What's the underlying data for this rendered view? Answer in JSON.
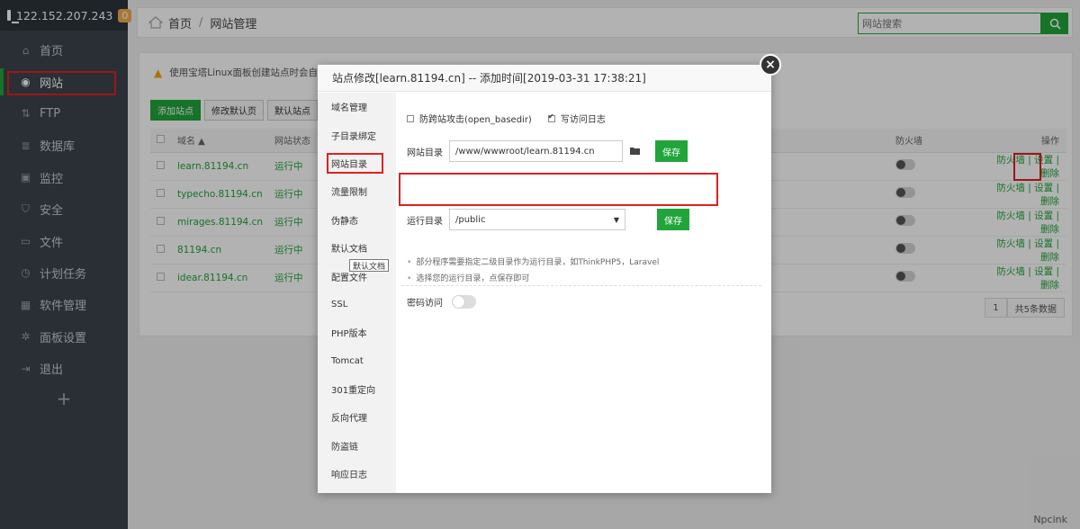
{
  "sidebar": {
    "ip": "122.152.207.243",
    "badge": "0",
    "items": [
      {
        "label": "首页",
        "icon": "home-icon"
      },
      {
        "label": "网站",
        "icon": "globe-icon"
      },
      {
        "label": "FTP",
        "icon": "ftp-icon"
      },
      {
        "label": "数据库",
        "icon": "database-icon"
      },
      {
        "label": "监控",
        "icon": "monitor-icon"
      },
      {
        "label": "安全",
        "icon": "shield-icon"
      },
      {
        "label": "文件",
        "icon": "folder-icon"
      },
      {
        "label": "计划任务",
        "icon": "clock-icon"
      },
      {
        "label": "软件管理",
        "icon": "apps-icon"
      },
      {
        "label": "面板设置",
        "icon": "gear-icon"
      },
      {
        "label": "退出",
        "icon": "logout-icon"
      }
    ],
    "add": "+"
  },
  "breadcrumb": {
    "home": "首页",
    "sep": "/",
    "current": "网站管理"
  },
  "search": {
    "placeholder": "网站搜索"
  },
  "panel": {
    "warning": "使用宝塔Linux面板创建站点时会自动创",
    "buttons": {
      "add": "添加站点",
      "default_page": "修改默认页",
      "default_site": "默认站点"
    },
    "columns": {
      "domain": "域名 ▲",
      "status": "网站状态",
      "firewall": "防火墙",
      "ops": "操作"
    },
    "rows": [
      {
        "domain": "learn.81194.cn",
        "status": "运行中"
      },
      {
        "domain": "typecho.81194.cn",
        "status": "运行中"
      },
      {
        "domain": "mirages.81194.cn",
        "status": "运行中"
      },
      {
        "domain": "81194.cn",
        "status": "运行中"
      },
      {
        "domain": "idear.81194.cn",
        "status": "运行中"
      }
    ],
    "ops": {
      "firewall": "防火墙",
      "sep": " | ",
      "settings": "设置",
      "delete": "删除"
    },
    "pager": {
      "page": "1",
      "total": "共5条数据"
    }
  },
  "modal": {
    "title": "站点修改[learn.81194.cn] -- 添加时间[2019-03-31 17:38:21]",
    "close": "×",
    "menu": [
      "域名管理",
      "子目录绑定",
      "网站目录",
      "流量限制",
      "伪静态",
      "默认文档",
      "配置文件",
      "SSL",
      "PHP版本",
      "Tomcat",
      "301重定向",
      "反向代理",
      "防盗链",
      "响应日志"
    ],
    "anti_xss_label": "防跨站攻击(open_basedir)",
    "log_label": "写访问日志",
    "site_dir_label": "网站目录",
    "site_dir_value": "/www/wwwroot/learn.81194.cn",
    "run_dir_label": "运行目录",
    "run_dir_value": "/public",
    "save": "保存",
    "tips": [
      "部分程序需要指定二级目录作为运行目录，如ThinkPHP5，Laravel",
      "选择您的运行目录，点保存即可"
    ],
    "password_label": "密码访问",
    "tooltip": "默认文档"
  },
  "watermark": "Npcink"
}
